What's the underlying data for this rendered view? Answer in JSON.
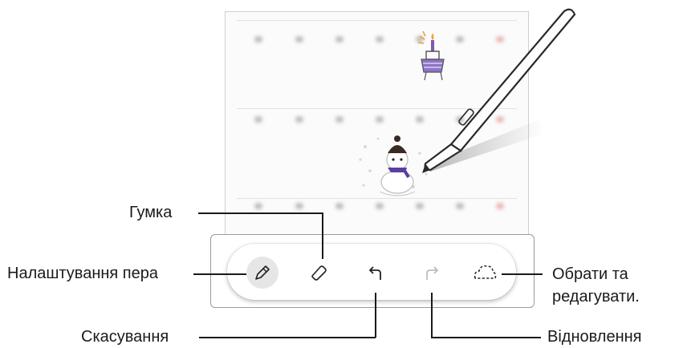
{
  "callouts": {
    "eraser": "Гумка",
    "pen_settings": "Налаштування пера",
    "undo": "Скасування",
    "redo": "Відновлення",
    "select_edit": "Обрати та редагувати."
  },
  "toolbar": {
    "tools": [
      {
        "name": "pen-settings",
        "icon": "pen-icon",
        "active": true
      },
      {
        "name": "eraser",
        "icon": "eraser-icon"
      },
      {
        "name": "undo",
        "icon": "undo-arrow-icon"
      },
      {
        "name": "redo",
        "icon": "redo-arrow-icon",
        "disabled": true
      },
      {
        "name": "select-edit",
        "icon": "lasso-select-icon"
      }
    ]
  },
  "colors": {
    "pen_body": "#3a3a3a",
    "toolbar_frame": "#9a9a9a",
    "drawing_accent": "#7a5cb0"
  }
}
